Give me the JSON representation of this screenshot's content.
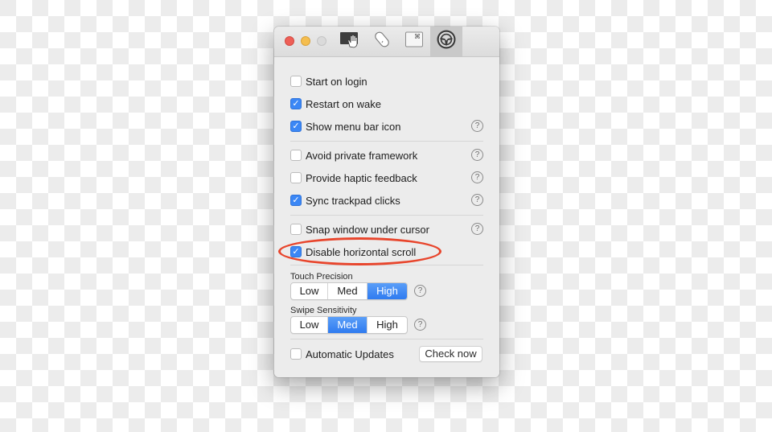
{
  "toolbar": {
    "tabs": [
      {
        "name": "gestures",
        "icon": "trackpad-hand-icon",
        "active": false
      },
      {
        "name": "mouse",
        "icon": "mouse-icon",
        "active": false
      },
      {
        "name": "keyboard",
        "icon": "keyboard-command-icon",
        "active": false
      },
      {
        "name": "general",
        "icon": "steering-wheel-icon",
        "active": true
      }
    ]
  },
  "options": {
    "group1": [
      {
        "label": "Start on login",
        "checked": false,
        "help": false
      },
      {
        "label": "Restart on wake",
        "checked": true,
        "help": false
      },
      {
        "label": "Show menu bar icon",
        "checked": true,
        "help": true
      }
    ],
    "group2": [
      {
        "label": "Avoid private framework",
        "checked": false,
        "help": true
      },
      {
        "label": "Provide haptic feedback",
        "checked": false,
        "help": true
      },
      {
        "label": "Sync trackpad clicks",
        "checked": true,
        "help": true
      }
    ],
    "group3": [
      {
        "label": "Snap window under cursor",
        "checked": false,
        "help": true
      },
      {
        "label": "Disable horizontal scroll",
        "checked": true,
        "help": false
      }
    ]
  },
  "touch_precision": {
    "label": "Touch Precision",
    "options": [
      "Low",
      "Med",
      "High"
    ],
    "selected": "High"
  },
  "swipe_sensitivity": {
    "label": "Swipe Sensitivity",
    "options": [
      "Low",
      "Med",
      "High"
    ],
    "selected": "Med"
  },
  "updates": {
    "label": "Automatic Updates",
    "checked": false,
    "button": "Check now"
  },
  "help_glyph": "?",
  "check_glyph": "✓",
  "annotation": {
    "target": "Disable horizontal scroll",
    "color": "#e8452c"
  }
}
